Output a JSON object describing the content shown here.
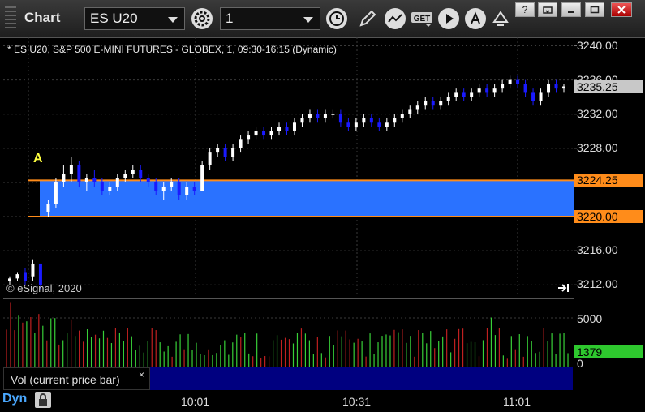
{
  "toolbar": {
    "title": "Chart",
    "symbol": "ES U20",
    "interval": "1",
    "get_label": "GET"
  },
  "chart_info": "* ES U20, S&P 500 E-MINI FUTURES - GLOBEX, 1, 09:30-16:15 (Dynamic)",
  "copyright": "© eSignal, 2020",
  "marker_label": "A",
  "vol_legend": "Vol (current price bar)",
  "vol_close": "×",
  "dyn_label": "Dyn",
  "colors": {
    "up": "#ffffff",
    "down": "#1a1aff",
    "band": "#2a72ff",
    "level": "#ff8c1a",
    "last_price": "#c8c8c8",
    "vol_up": "#38d038",
    "vol_down": "#c02020",
    "vol_last": "#2ec82e"
  },
  "axis": {
    "labels": [
      "3240.00",
      "3236.00",
      "3232.00",
      "3228.00",
      "3224.00",
      "3220.00",
      "3216.00",
      "3212.00"
    ],
    "last_price": "3235.25",
    "level_upper": "3224.25",
    "level_lower": "3220.00",
    "vol_labels": [
      "5000",
      "0"
    ],
    "vol_last": "1379"
  },
  "time_labels": [
    "10:01",
    "10:31",
    "11:01"
  ],
  "chart_data": {
    "type": "candlestick",
    "y_range": [
      3210.6,
      3241.0
    ],
    "levels": [
      3224.25,
      3220.0
    ],
    "last_price": 3235.25,
    "bars_approx": [
      [
        3212.5,
        3213.0,
        3212.0,
        3212.75
      ],
      [
        3212.75,
        3213.5,
        3212.5,
        3213.25
      ],
      [
        3213.5,
        3214.0,
        3212.0,
        3212.5
      ],
      [
        3213.0,
        3215.0,
        3212.5,
        3214.5
      ],
      [
        3214.5,
        3214.5,
        3211.5,
        3212.0
      ],
      [
        3220.5,
        3222.0,
        3220.0,
        3221.5
      ],
      [
        3221.5,
        3224.5,
        3221.0,
        3224.0
      ],
      [
        3224.0,
        3226.0,
        3223.5,
        3225.0
      ],
      [
        3225.0,
        3227.0,
        3224.0,
        3226.0
      ],
      [
        3226.0,
        3226.5,
        3223.5,
        3224.0
      ],
      [
        3224.0,
        3225.0,
        3223.0,
        3224.5
      ],
      [
        3224.5,
        3225.5,
        3223.5,
        3224.0
      ],
      [
        3224.0,
        3224.5,
        3222.5,
        3223.0
      ],
      [
        3223.0,
        3224.0,
        3222.5,
        3223.5
      ],
      [
        3223.5,
        3225.0,
        3223.0,
        3224.5
      ],
      [
        3224.5,
        3225.5,
        3224.0,
        3225.0
      ],
      [
        3225.0,
        3226.0,
        3224.5,
        3225.5
      ],
      [
        3225.5,
        3226.0,
        3224.0,
        3224.5
      ],
      [
        3224.5,
        3225.0,
        3223.5,
        3224.0
      ],
      [
        3224.0,
        3224.5,
        3222.5,
        3223.0
      ],
      [
        3223.0,
        3224.0,
        3222.0,
        3223.5
      ],
      [
        3223.5,
        3224.5,
        3223.0,
        3224.0
      ],
      [
        3224.0,
        3224.5,
        3222.0,
        3222.5
      ],
      [
        3222.5,
        3224.0,
        3222.0,
        3223.5
      ],
      [
        3223.5,
        3224.0,
        3222.5,
        3223.0
      ],
      [
        3223.0,
        3226.5,
        3223.0,
        3226.0
      ],
      [
        3226.0,
        3228.0,
        3225.5,
        3227.5
      ],
      [
        3227.5,
        3228.5,
        3227.0,
        3228.0
      ],
      [
        3228.0,
        3228.5,
        3226.5,
        3227.0
      ],
      [
        3227.0,
        3228.5,
        3226.5,
        3228.0
      ],
      [
        3228.0,
        3229.5,
        3227.5,
        3229.0
      ],
      [
        3229.0,
        3230.0,
        3228.5,
        3229.5
      ],
      [
        3229.5,
        3230.5,
        3229.0,
        3230.0
      ],
      [
        3230.0,
        3230.5,
        3229.0,
        3229.5
      ],
      [
        3229.5,
        3230.5,
        3229.0,
        3230.0
      ],
      [
        3230.0,
        3231.0,
        3229.5,
        3230.5
      ],
      [
        3230.5,
        3231.0,
        3229.5,
        3230.0
      ],
      [
        3230.0,
        3231.5,
        3229.5,
        3231.0
      ],
      [
        3231.0,
        3232.0,
        3230.5,
        3231.5
      ],
      [
        3231.5,
        3232.5,
        3231.0,
        3232.0
      ],
      [
        3232.0,
        3232.5,
        3231.0,
        3231.5
      ],
      [
        3231.5,
        3232.5,
        3231.0,
        3232.0
      ],
      [
        3232.0,
        3232.5,
        3231.5,
        3232.0
      ],
      [
        3232.0,
        3232.5,
        3230.5,
        3231.0
      ],
      [
        3231.0,
        3231.5,
        3230.0,
        3230.5
      ],
      [
        3230.5,
        3231.5,
        3230.0,
        3231.0
      ],
      [
        3231.0,
        3232.0,
        3230.5,
        3231.5
      ],
      [
        3231.5,
        3232.0,
        3230.5,
        3231.0
      ],
      [
        3231.0,
        3231.5,
        3230.0,
        3230.5
      ],
      [
        3230.5,
        3231.5,
        3230.0,
        3231.0
      ],
      [
        3231.0,
        3232.0,
        3230.5,
        3231.5
      ],
      [
        3231.5,
        3232.5,
        3231.0,
        3232.0
      ],
      [
        3232.0,
        3233.0,
        3231.5,
        3232.5
      ],
      [
        3232.5,
        3233.5,
        3232.0,
        3233.0
      ],
      [
        3233.0,
        3234.0,
        3232.5,
        3233.5
      ],
      [
        3233.5,
        3234.0,
        3232.5,
        3233.0
      ],
      [
        3233.0,
        3234.0,
        3232.5,
        3233.5
      ],
      [
        3233.5,
        3234.5,
        3233.0,
        3234.0
      ],
      [
        3234.0,
        3235.0,
        3233.5,
        3234.5
      ],
      [
        3234.5,
        3235.0,
        3233.5,
        3234.0
      ],
      [
        3234.0,
        3235.0,
        3233.5,
        3234.5
      ],
      [
        3234.5,
        3235.5,
        3234.0,
        3235.0
      ],
      [
        3235.0,
        3235.5,
        3234.0,
        3234.5
      ],
      [
        3234.5,
        3235.5,
        3234.0,
        3235.0
      ],
      [
        3235.0,
        3236.0,
        3234.5,
        3235.5
      ],
      [
        3235.5,
        3236.5,
        3235.0,
        3236.0
      ],
      [
        3236.0,
        3236.5,
        3235.0,
        3235.5
      ],
      [
        3235.5,
        3236.0,
        3234.0,
        3234.5
      ],
      [
        3234.5,
        3235.0,
        3233.0,
        3233.5
      ],
      [
        3233.5,
        3235.0,
        3233.0,
        3234.5
      ],
      [
        3234.5,
        3236.0,
        3234.0,
        3235.5
      ],
      [
        3235.5,
        3236.0,
        3234.5,
        3235.0
      ],
      [
        3235.0,
        3235.5,
        3234.5,
        3235.25
      ]
    ],
    "volume_range": [
      0,
      7000
    ],
    "volume_last": 1379
  }
}
